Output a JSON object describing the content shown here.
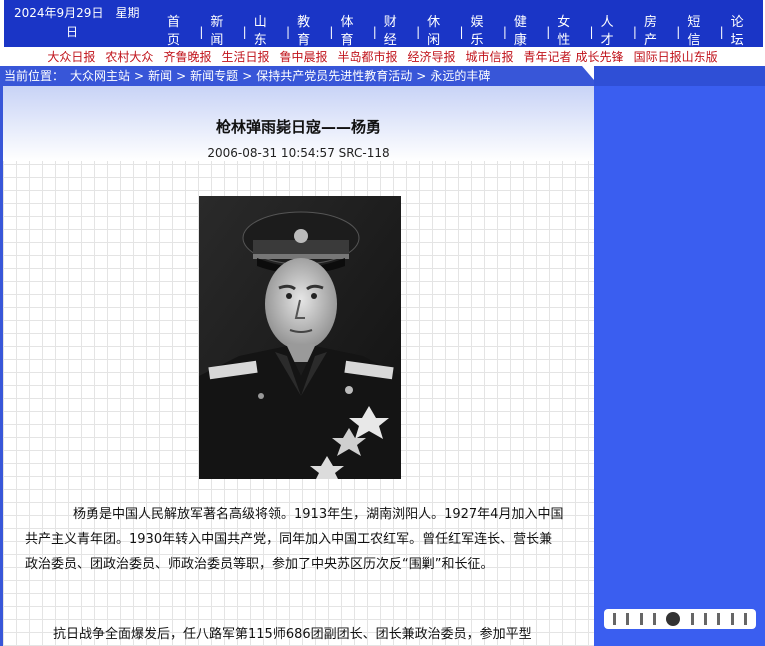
{
  "header": {
    "date_line1": "2024年9月29日　星期",
    "date_line2": "日",
    "nav": [
      "首页",
      "新闻",
      "山东",
      "教育",
      "体育",
      "财经",
      "休闲",
      "娱乐",
      "健康",
      "女性",
      "人才",
      "房产",
      "短信",
      "论坛"
    ]
  },
  "partners": [
    "大众日报",
    "农村大众",
    "齐鲁晚报",
    "生活日报",
    "鲁中晨报",
    "半岛都市报",
    "经济导报",
    "城市信报",
    "青年记者",
    "成长先锋",
    "国际日报山东版"
  ],
  "breadcrumb": {
    "prefix": "当前位置：",
    "items": [
      "大众网主站",
      "新闻",
      "新闻专题",
      "保持共产党员先进性教育活动",
      "永远的丰碑"
    ]
  },
  "article": {
    "title": "枪林弹雨毙日寇——杨勇",
    "meta": "2006-08-31 10:54:57 SRC-118",
    "paragraphs": [
      "杨勇是中国人民解放军著名高级将领。1913年生，湖南浏阳人。1927年4月加入中国共产主义青年团。1930年转入中国共产党，同年加入中国工农红军。曾任红军连长、营长兼政治委员、团政治委员、师政治委员等职，参加了中央苏区历次反“围剿”和长征。",
      "抗日战争全面爆发后，任八路军第115师686团副团长、团长兼政治委员，参加平型"
    ]
  },
  "colors": {
    "nav_bg": "#1a35c6",
    "breadcrumb_bg": "#3856d8",
    "sidebar_bg": "#3a5ef0",
    "partner_text": "#c0131b"
  }
}
